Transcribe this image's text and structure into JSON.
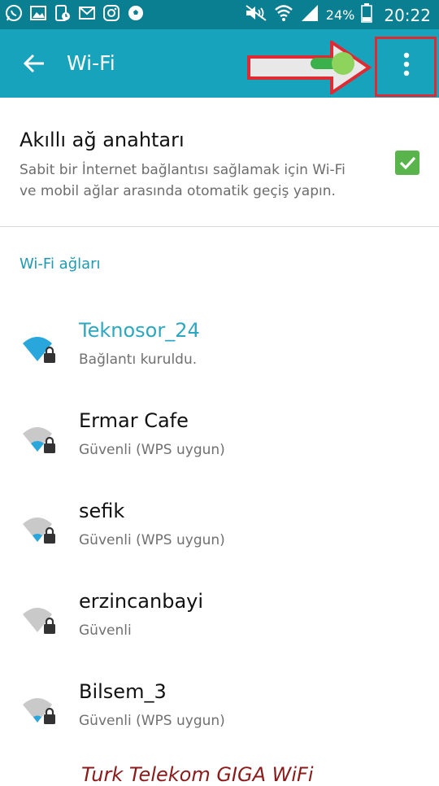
{
  "status_bar": {
    "battery": "24%",
    "time": "20:22",
    "left_icons": [
      "whatsapp-icon",
      "image-icon",
      "phone-clock-icon",
      "gmail-icon",
      "instagram-icon",
      "soccer-ball-icon"
    ]
  },
  "toolbar": {
    "title": "Wi-Fi",
    "toggle_on": true
  },
  "smart_switch": {
    "title": "Akıllı ağ anahtarı",
    "description": "Sabit bir İnternet bağlantısı sağlamak için Wi-Fi ve mobil ağlar arasında otomatik geçiş yapın.",
    "checked": true
  },
  "section_header": "Wi-Fi ağları",
  "networks": [
    {
      "name": "Teknosor_24",
      "status": "Bağlantı kuruldu.",
      "connected": true
    },
    {
      "name": "Ermar Cafe",
      "status": "Güvenli (WPS uygun)",
      "connected": false
    },
    {
      "name": "sefik",
      "status": "Güvenli (WPS uygun)",
      "connected": false
    },
    {
      "name": "erzincanbayi",
      "status": "Güvenli",
      "connected": false
    },
    {
      "name": "Bilsem_3",
      "status": "Güvenli (WPS uygun)",
      "connected": false
    }
  ],
  "partial_network": "Turk Telekom GIGA WiFi",
  "colors": {
    "status_bar": "#0a7f92",
    "toolbar": "#18a3bd",
    "accent": "#2da7c0",
    "checkbox": "#58b44b",
    "annotation_red": "#e02a33"
  }
}
